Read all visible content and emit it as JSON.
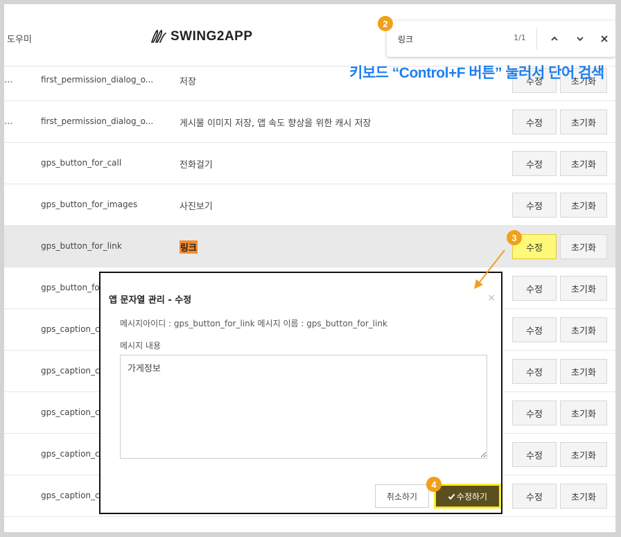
{
  "header": {
    "help_label": "도우미",
    "logo_text": "SWING2APP"
  },
  "findbar": {
    "query": "링크",
    "count": "1/1",
    "badge": "2"
  },
  "annotation": "키보드 “Control+F 버튼” 눌러서 단어 검색",
  "rows": [
    {
      "trunc": "...",
      "id": "first_permission_dialog_o...",
      "name": "저장",
      "edit": "수정",
      "reset": "초기화"
    },
    {
      "trunc": "...",
      "id": "first_permission_dialog_o...",
      "name": "게시물 이미지 저장, 앱 속도 향상을 위한 캐시 저장",
      "edit": "수정",
      "reset": "초기화"
    },
    {
      "trunc": "",
      "id": "gps_button_for_call",
      "name": "전화걸기",
      "edit": "수정",
      "reset": "초기화"
    },
    {
      "trunc": "",
      "id": "gps_button_for_images",
      "name": "사진보기",
      "edit": "수정",
      "reset": "초기화"
    },
    {
      "trunc": "",
      "id": "gps_button_for_link",
      "name": "링크",
      "edit": "수정",
      "reset": "초기화",
      "badge": "3"
    },
    {
      "trunc": "",
      "id": "gps_button_fo",
      "name": "",
      "edit": "수정",
      "reset": "초기화"
    },
    {
      "trunc": "",
      "id": "gps_caption_c",
      "name": "",
      "edit": "수정",
      "reset": "초기화"
    },
    {
      "trunc": "",
      "id": "gps_caption_c",
      "name": "",
      "edit": "수정",
      "reset": "초기화"
    },
    {
      "trunc": "",
      "id": "gps_caption_c",
      "name": "",
      "edit": "수정",
      "reset": "초기화"
    },
    {
      "trunc": "",
      "id": "gps_caption_c",
      "name": "",
      "edit": "수정",
      "reset": "초기화"
    },
    {
      "trunc": "",
      "id": "gps_caption_c",
      "name": "",
      "edit": "수정",
      "reset": "초기화"
    }
  ],
  "modal": {
    "title": "앱 문자열 관리 - 수정",
    "info": "메시지아이디 : gps_button_for_link 메시지 이름 : gps_button_for_link",
    "content_label": "메시지 내용",
    "content_value": "가게정보",
    "cancel_label": "취소하기",
    "save_label": "수정하기",
    "save_badge": "4"
  },
  "colors": {
    "annotation": "#1e7ff0",
    "badge": "#f0a01a",
    "highlight": "#f58a2c",
    "save_button": "#5b4f1f",
    "save_border": "#f6ef27"
  }
}
